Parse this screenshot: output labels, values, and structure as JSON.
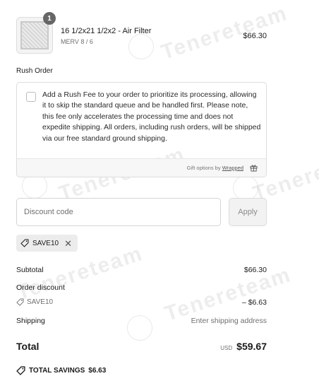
{
  "product": {
    "quantity_badge": "1",
    "name": "16 1/2x21 1/2x2 - Air Filter",
    "variant": "MERV 8 / 6",
    "price": "$66.30"
  },
  "rush_order": {
    "title": "Rush Order",
    "description": "Add a Rush Fee to your order to prioritize its processing, allowing it to skip the standard queue and be handled first. Please note, this fee only accelerates the processing time and does not expedite shipping. All orders, including rush orders, will be shipped via our free standard ground shipping.",
    "checked": false,
    "gift_prefix": "Gift options by",
    "gift_brand": "Wrapped"
  },
  "discount": {
    "placeholder": "Discount code",
    "value": "",
    "apply_label": "Apply",
    "applied_code": "SAVE10"
  },
  "summary": {
    "subtotal_label": "Subtotal",
    "subtotal_value": "$66.30",
    "order_discount_label": "Order discount",
    "discount_code": "SAVE10",
    "discount_value": "– $6.63",
    "shipping_label": "Shipping",
    "shipping_value": "Enter shipping address",
    "total_label": "Total",
    "currency": "USD",
    "total_value": "$59.67",
    "savings_label": "TOTAL SAVINGS",
    "savings_value": "$6.63"
  },
  "watermark": {
    "text": "Tenereteam"
  },
  "icons": {
    "tag": "tag-icon",
    "gift": "gift-icon",
    "close": "close-icon"
  }
}
